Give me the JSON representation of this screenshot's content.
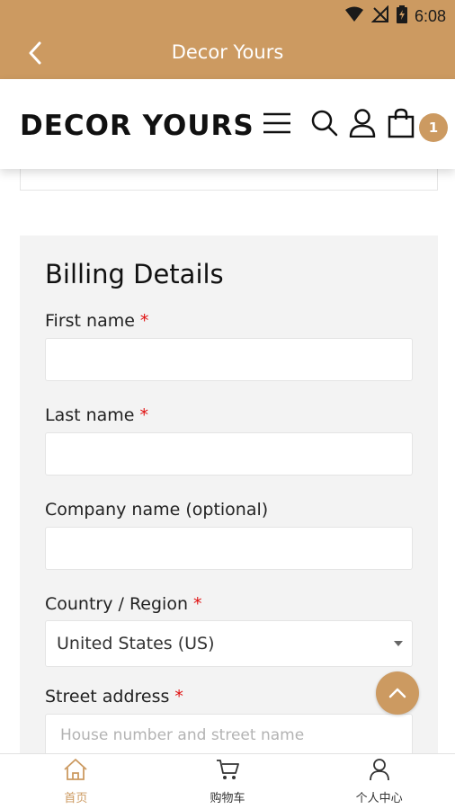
{
  "status_bar": {
    "time": "6:08"
  },
  "app_bar": {
    "title": "Decor Yours"
  },
  "header": {
    "logo": "DECOR YOURS",
    "cart_count": "1"
  },
  "billing": {
    "title": "Billing Details",
    "required_marker": "*",
    "fields": {
      "first_name": {
        "label": "First name",
        "value": "",
        "required": true
      },
      "last_name": {
        "label": "Last name",
        "value": "",
        "required": true
      },
      "company": {
        "label": "Company name (optional)",
        "value": "",
        "required": false
      },
      "country": {
        "label": "Country / Region",
        "selected": "United States (US)",
        "required": true
      },
      "street": {
        "label": "Street address",
        "placeholder": "House number and street name",
        "required": true
      }
    }
  },
  "bottom_nav": {
    "items": [
      {
        "label": "首页",
        "icon": "home-icon",
        "active": true
      },
      {
        "label": "购物车",
        "icon": "cart-icon",
        "active": false
      },
      {
        "label": "个人中心",
        "icon": "user-icon",
        "active": false
      }
    ]
  },
  "colors": {
    "accent": "#cc9a61",
    "required": "#e01010",
    "card_bg": "#f3f3f3"
  }
}
